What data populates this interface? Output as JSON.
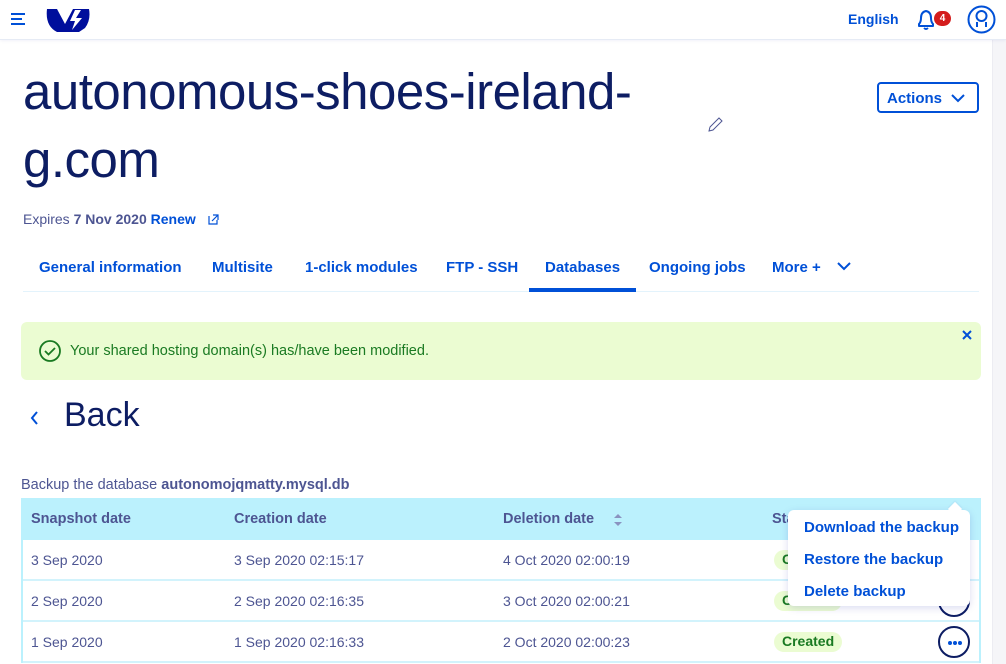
{
  "topbar": {
    "language": "English",
    "notification_count": "4"
  },
  "header": {
    "title": "autonomous-shoes-ireland-g.com",
    "actions_label": "Actions",
    "expires_label": "Expires",
    "expires_date": "7 Nov 2020",
    "renew_label": "Renew"
  },
  "tabs": [
    {
      "label": "General information",
      "active": false
    },
    {
      "label": "Multisite",
      "active": false
    },
    {
      "label": "1-click modules",
      "active": false
    },
    {
      "label": "FTP - SSH",
      "active": false
    },
    {
      "label": "Databases",
      "active": true
    },
    {
      "label": "Ongoing jobs",
      "active": false
    },
    {
      "label": "More +",
      "active": false
    }
  ],
  "alert": {
    "type": "success",
    "message": "Your shared hosting domain(s) has/have been modified."
  },
  "back_label": "Back",
  "caption": {
    "prefix": "Backup the database",
    "database": "autonomojqmatty.mysql.db"
  },
  "table": {
    "columns": [
      "Snapshot date",
      "Creation date",
      "Deletion date",
      "Status"
    ],
    "rows": [
      {
        "snapshot": "3 Sep 2020",
        "creation": "3 Sep 2020 02:15:17",
        "deletion": "4 Oct 2020 02:00:19",
        "status": "Created"
      },
      {
        "snapshot": "2 Sep 2020",
        "creation": "2 Sep 2020 02:16:35",
        "deletion": "3 Oct 2020 02:00:21",
        "status": "Created"
      },
      {
        "snapshot": "1 Sep 2020",
        "creation": "1 Sep 2020 02:16:33",
        "deletion": "2 Oct 2020 02:00:23",
        "status": "Created"
      }
    ]
  },
  "row_menu": {
    "items": [
      "Download the backup",
      "Restore the backup",
      "Delete backup"
    ]
  },
  "colors": {
    "primary": "#0050d7",
    "title": "#0d1d63",
    "text": "#4d5592",
    "success_bg": "#ebfcd2",
    "success_text": "#1a7a22",
    "table_header_bg": "#bbf1fd",
    "badge": "#d41d1d"
  }
}
